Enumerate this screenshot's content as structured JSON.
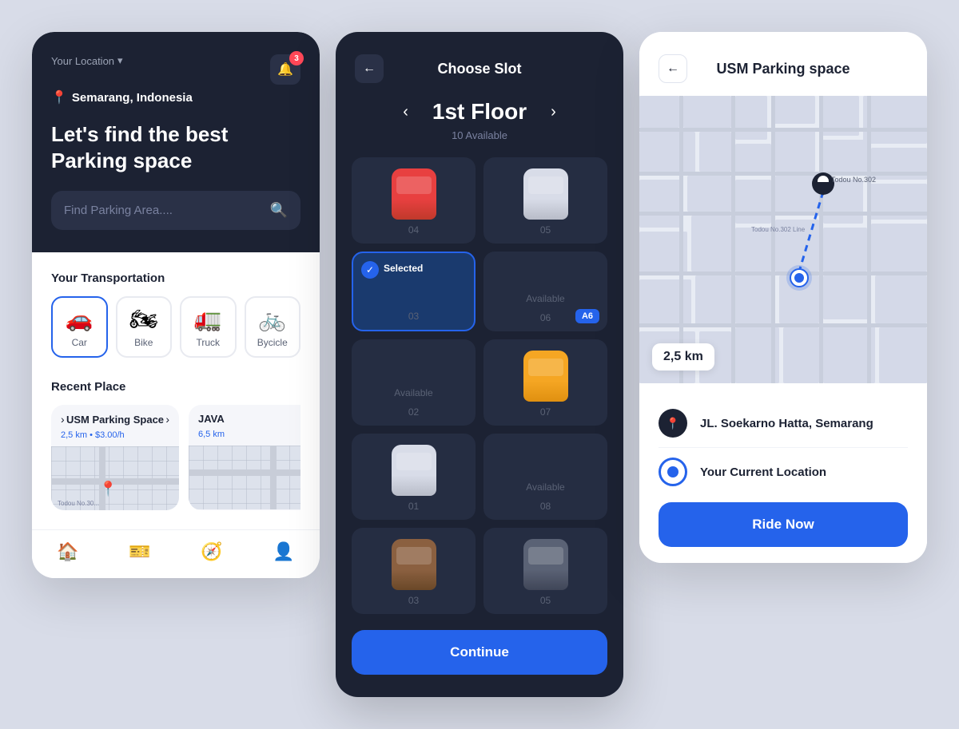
{
  "screen1": {
    "header": {
      "location_label": "Your Location",
      "chevron": "▾",
      "city": "Semarang, Indonesia",
      "notification_count": "3",
      "headline_line1": "Let's find the best",
      "headline_line2": "Parking space",
      "search_placeholder": "Find Parking Area...."
    },
    "transport": {
      "section_title": "Your Transportation",
      "items": [
        {
          "label": "Car",
          "emoji": "🚗",
          "active": true
        },
        {
          "label": "Bike",
          "emoji": "🏍",
          "active": false
        },
        {
          "label": "Truck",
          "emoji": "🚛",
          "active": false
        },
        {
          "label": "Bycicle",
          "emoji": "🚲",
          "active": false
        }
      ]
    },
    "recent": {
      "section_title": "Recent Place",
      "items": [
        {
          "name": "USM Parking Space",
          "meta": "2,5 km  •  $3.00/h"
        },
        {
          "name": "JAVA",
          "meta": "6,5 km"
        }
      ]
    },
    "nav": {
      "items": [
        "🏠",
        "🎫",
        "🧭",
        "👤"
      ]
    }
  },
  "screen2": {
    "header": {
      "back_icon": "←",
      "title": "Choose Slot"
    },
    "floor": {
      "prev_icon": "‹",
      "next_icon": "›",
      "name": "1st Floor",
      "available": "10 Available"
    },
    "slots": [
      {
        "id": "04",
        "type": "car-red",
        "selected": false,
        "available": false
      },
      {
        "id": "05",
        "type": "car-white",
        "selected": false,
        "available": false
      },
      {
        "id": "03",
        "type": "selected",
        "label": "Selected",
        "selected": true,
        "available": false
      },
      {
        "id": "06",
        "type": "available",
        "label": "Available",
        "badge": "A6",
        "available": true
      },
      {
        "id": "02",
        "type": "available-empty",
        "label": "Available",
        "available": true
      },
      {
        "id": "07",
        "type": "car-yellow",
        "selected": false,
        "available": false
      },
      {
        "id": "01",
        "type": "car-white2",
        "selected": false,
        "available": false
      },
      {
        "id": "08",
        "type": "available",
        "label": "Available",
        "available": true
      },
      {
        "id": "03b",
        "type": "car-brown",
        "selected": false,
        "available": false
      },
      {
        "id": "05b",
        "type": "car-dark",
        "selected": false,
        "available": false
      }
    ],
    "continue_btn": "Continue"
  },
  "screen3": {
    "header": {
      "back_icon": "←",
      "title": "USM Parking space"
    },
    "distance": "2,5 km",
    "map_label1": "Todou No.302",
    "map_label2": "Todou No.302 Line",
    "route": [
      {
        "type": "pin",
        "text": "JL. Soekarno Hatta, Semarang"
      },
      {
        "type": "dot",
        "text": "Your Current Location"
      }
    ],
    "ride_btn": "Ride Now"
  }
}
